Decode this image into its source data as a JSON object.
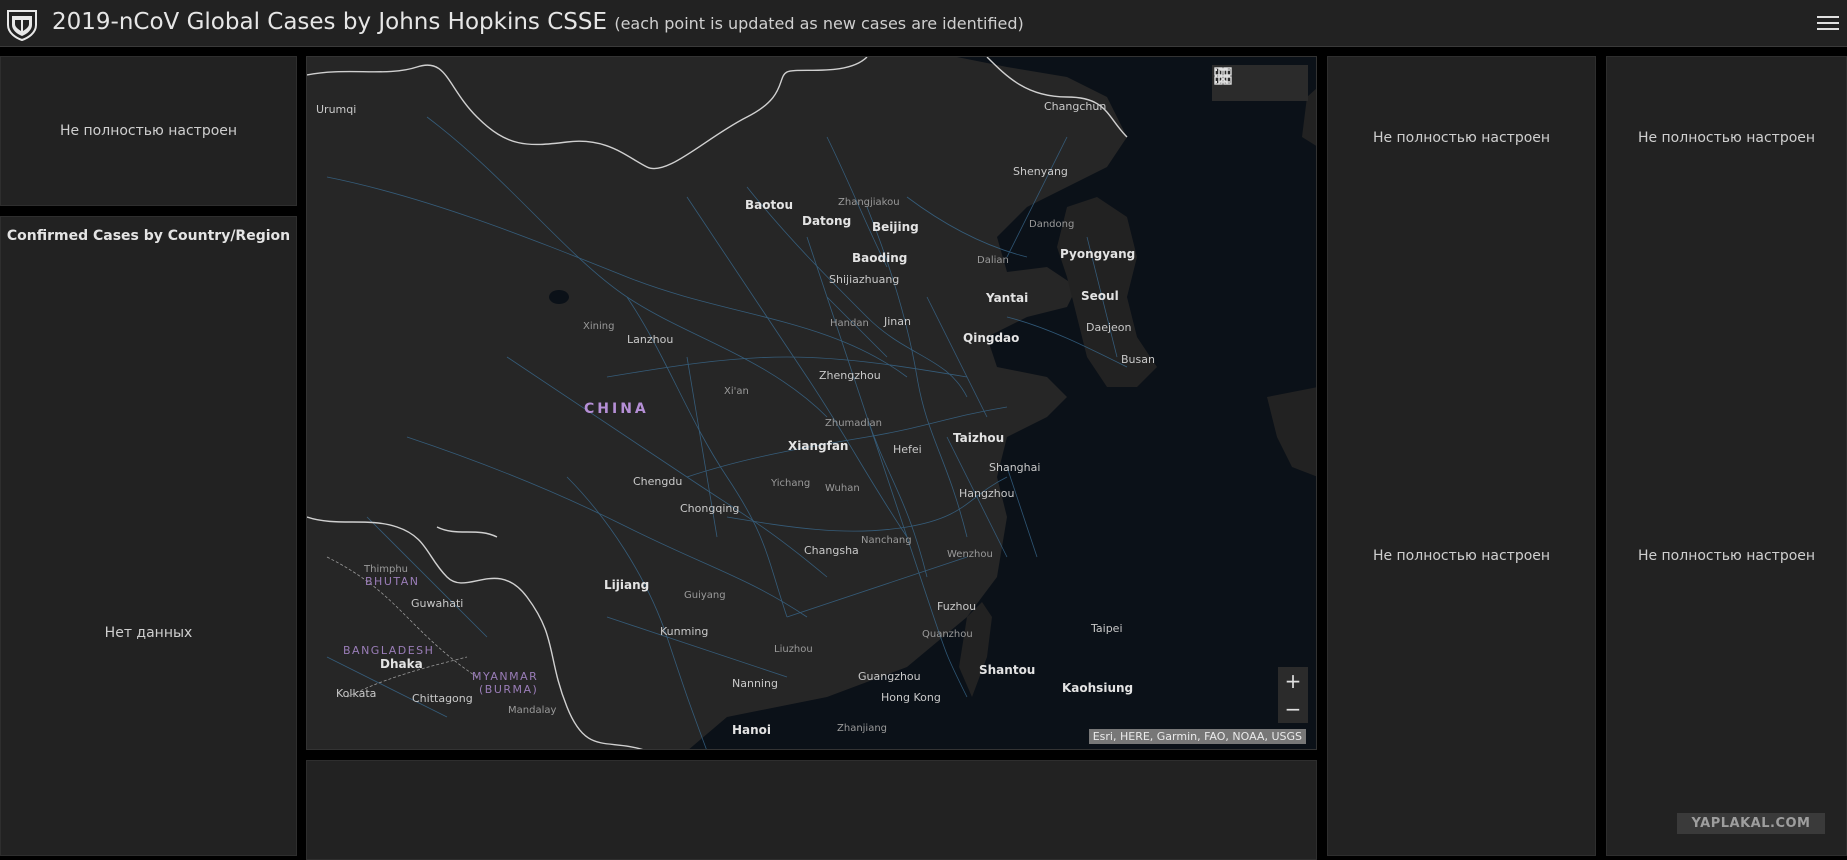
{
  "header": {
    "title": "2019-nCoV Global Cases by Johns Hopkins CSSE",
    "subtitle": "(each point is updated as new cases are identified)",
    "logo_icon": "jhu-shield-icon",
    "menu_icon": "hamburger-menu-icon"
  },
  "left_top_panel": {
    "message": "Не полностью настроен"
  },
  "left_list_panel": {
    "title": "Confirmed Cases by Country/Region",
    "message": "Нет данных"
  },
  "right_panels": {
    "col1_top": "Не полностью настроен",
    "col1_bottom": "Не полностью настроен",
    "col2_top": "Не полностью настроен",
    "col2_bottom": "Не полностью настроен"
  },
  "map": {
    "tools": [
      "bookmark-icon",
      "legend-list-icon",
      "basemap-gallery-icon"
    ],
    "zoom_in": "+",
    "zoom_out": "−",
    "attribution": "Esri, HERE, Garmin, FAO, NOAA, USGS",
    "countries": [
      "CHINA",
      "BHUTAN",
      "BANGLADESH",
      "MYANMAR",
      "(BURMA)"
    ],
    "cities": [
      "Urumqi",
      "Changchun",
      "Shenyang",
      "Dandong",
      "Pyongyang",
      "Dalian",
      "Baotou",
      "Zhangjiakou",
      "Datong",
      "Beijing",
      "Baoding",
      "Shijiazhuang",
      "Yantai",
      "Seoul",
      "Daejeon",
      "Busan",
      "Xining",
      "Lanzhou",
      "Handan",
      "Jinan",
      "Qingdao",
      "Zhengzhou",
      "Xi'an",
      "Zhumadian",
      "Taizhou",
      "Xiangfan",
      "Hefei",
      "Shanghai",
      "Chengdu",
      "Yichang",
      "Wuhan",
      "Hangzhou",
      "Chongqing",
      "Nanchang",
      "Changsha",
      "Wenzhou",
      "Thimphu",
      "Guwahati",
      "Lijiang",
      "Guiyang",
      "Fuzhou",
      "Quanzhou",
      "Taipei",
      "Kunming",
      "Liuzhou",
      "Dhaka",
      "Nanning",
      "Guangzhou",
      "Shantou",
      "Kolkata",
      "Chittagong",
      "Mandalay",
      "Hong Kong",
      "Kaohsiung",
      "Hanoi",
      "Zhanjiang"
    ]
  },
  "watermark": "YAPLAKAL.COM",
  "colors": {
    "background": "#000000",
    "panel": "#222222",
    "ocean": "#0b1118",
    "land": "#262626",
    "roads": "#3b6f96",
    "country_label": "#b58fd6"
  }
}
